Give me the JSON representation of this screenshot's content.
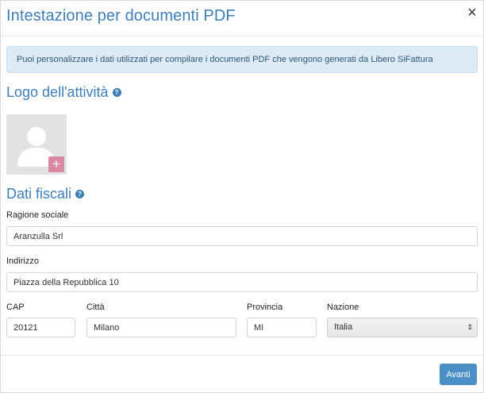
{
  "modal": {
    "title": "Intestazione per documenti PDF",
    "close_glyph": "×"
  },
  "info": {
    "text": "Puoi personalizzare i dati utilizzati per compilare i documenti PDF che vengono generati da Libero SiFattura"
  },
  "logo_section": {
    "title": "Logo dell'attività",
    "help_glyph": "?",
    "add_glyph": "+"
  },
  "fiscal_section": {
    "title": "Dati fiscali",
    "help_glyph": "?"
  },
  "fields": {
    "ragione_sociale": {
      "label": "Ragione sociale",
      "value": "Aranzulla Srl"
    },
    "indirizzo": {
      "label": "Indirizzo",
      "value": "Piazza della Repubblica 10"
    },
    "cap": {
      "label": "CAP",
      "value": "20121"
    },
    "citta": {
      "label": "Città",
      "value": "Milano"
    },
    "provincia": {
      "label": "Provincia",
      "value": "MI"
    },
    "nazione": {
      "label": "Nazione",
      "value": "Italia",
      "arrows": "⇕"
    }
  },
  "footer": {
    "next_label": "Avanti"
  },
  "colors": {
    "accent": "#3d7fb6",
    "info_bg": "#dcebf6",
    "button": "#4b8fc6",
    "add_logo": "#d98aa2"
  }
}
